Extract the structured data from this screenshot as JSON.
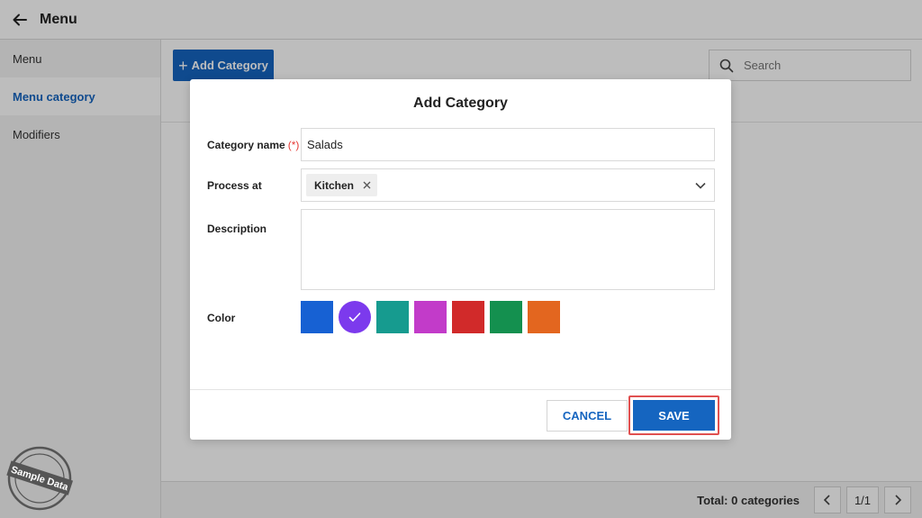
{
  "topbar": {
    "title": "Menu"
  },
  "sidebar": {
    "items": [
      {
        "label": "Menu"
      },
      {
        "label": "Menu category"
      },
      {
        "label": "Modifiers"
      }
    ]
  },
  "toolbar": {
    "add_label": "Add Category",
    "search_placeholder": "Search"
  },
  "footer": {
    "total": "Total: 0 categories",
    "page": "1/1"
  },
  "stamp": {
    "text": "Sample Data"
  },
  "modal": {
    "title": "Add Category",
    "category_name_label": "Category name",
    "required_marker": "(*)",
    "category_name_value": "Salads",
    "process_at_label": "Process at",
    "process_at_chip": "Kitchen",
    "description_label": "Description",
    "color_label": "Color",
    "colors": [
      "#1761d3",
      "#7c3aed",
      "#169b8f",
      "#c23bc9",
      "#d12a2a",
      "#14904f",
      "#e3661f"
    ],
    "selected_color_index": 1,
    "cancel_label": "CANCEL",
    "save_label": "SAVE"
  }
}
